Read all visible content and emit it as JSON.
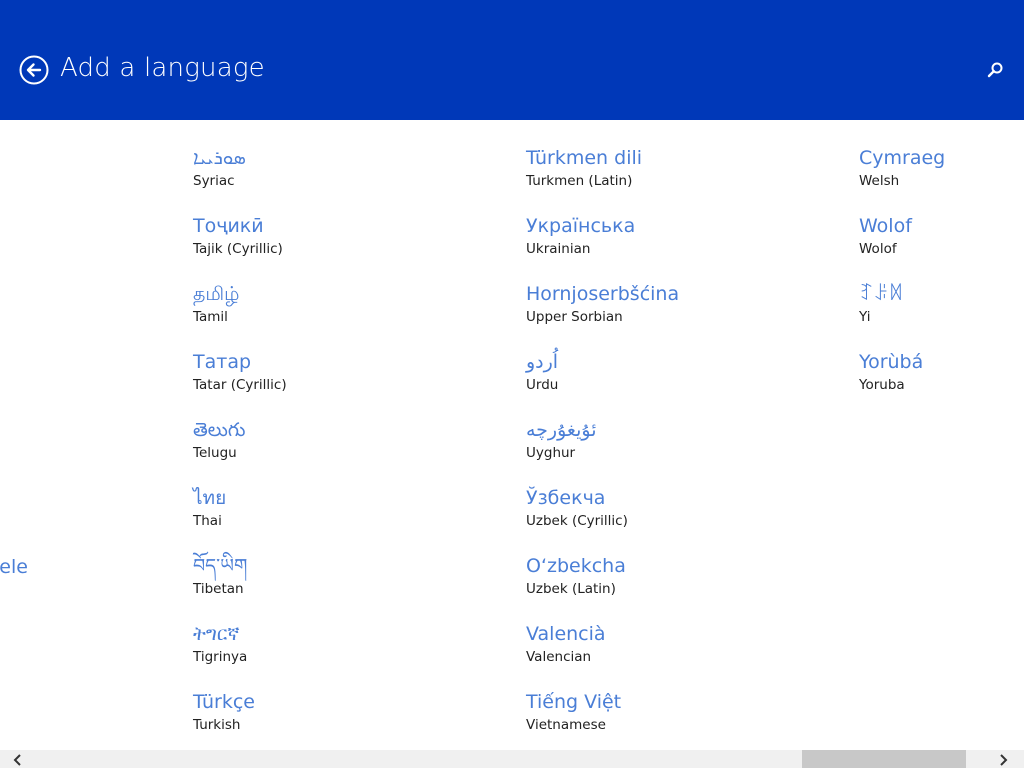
{
  "header": {
    "title": "Add a language",
    "back_icon": "back-arrow-icon",
    "search_icon": "search-icon",
    "background_color": "#0038b8"
  },
  "partial_item": {
    "native": "iele"
  },
  "columns": [
    {
      "items": [
        {
          "native": "ܣܘܪܝܝܐ",
          "english": "Syriac"
        },
        {
          "native": "Тоҷикӣ",
          "english": "Tajik (Cyrillic)"
        },
        {
          "native": "தமிழ்",
          "english": "Tamil"
        },
        {
          "native": "Татар",
          "english": "Tatar (Cyrillic)"
        },
        {
          "native": "తెలుగు",
          "english": "Telugu"
        },
        {
          "native": "ไทย",
          "english": "Thai"
        },
        {
          "native": "བོད་ཡིག",
          "english": "Tibetan"
        },
        {
          "native": "ትግርኛ",
          "english": "Tigrinya"
        },
        {
          "native": "Türkçe",
          "english": "Turkish"
        }
      ]
    },
    {
      "items": [
        {
          "native": "Türkmen dili",
          "english": "Turkmen (Latin)"
        },
        {
          "native": "Українська",
          "english": "Ukrainian"
        },
        {
          "native": "Hornjoserbšćina",
          "english": "Upper Sorbian"
        },
        {
          "native": "اُردو",
          "english": "Urdu"
        },
        {
          "native": "ئۇيغۇرچە",
          "english": "Uyghur"
        },
        {
          "native": "Ўзбекча",
          "english": "Uzbek (Cyrillic)"
        },
        {
          "native": "O‘zbekcha",
          "english": "Uzbek (Latin)"
        },
        {
          "native": "Valencià",
          "english": "Valencian"
        },
        {
          "native": "Tiếng Việt",
          "english": "Vietnamese"
        }
      ]
    },
    {
      "items": [
        {
          "native": "Cymraeg",
          "english": "Welsh"
        },
        {
          "native": "Wolof",
          "english": "Wolof"
        },
        {
          "native": "ꆈꌠꉙ",
          "english": "Yi"
        },
        {
          "native": "Yorùbá",
          "english": "Yoruba"
        }
      ]
    }
  ],
  "scrollbar": {
    "left_icon": "chevron-left-icon",
    "right_icon": "chevron-right-icon"
  }
}
